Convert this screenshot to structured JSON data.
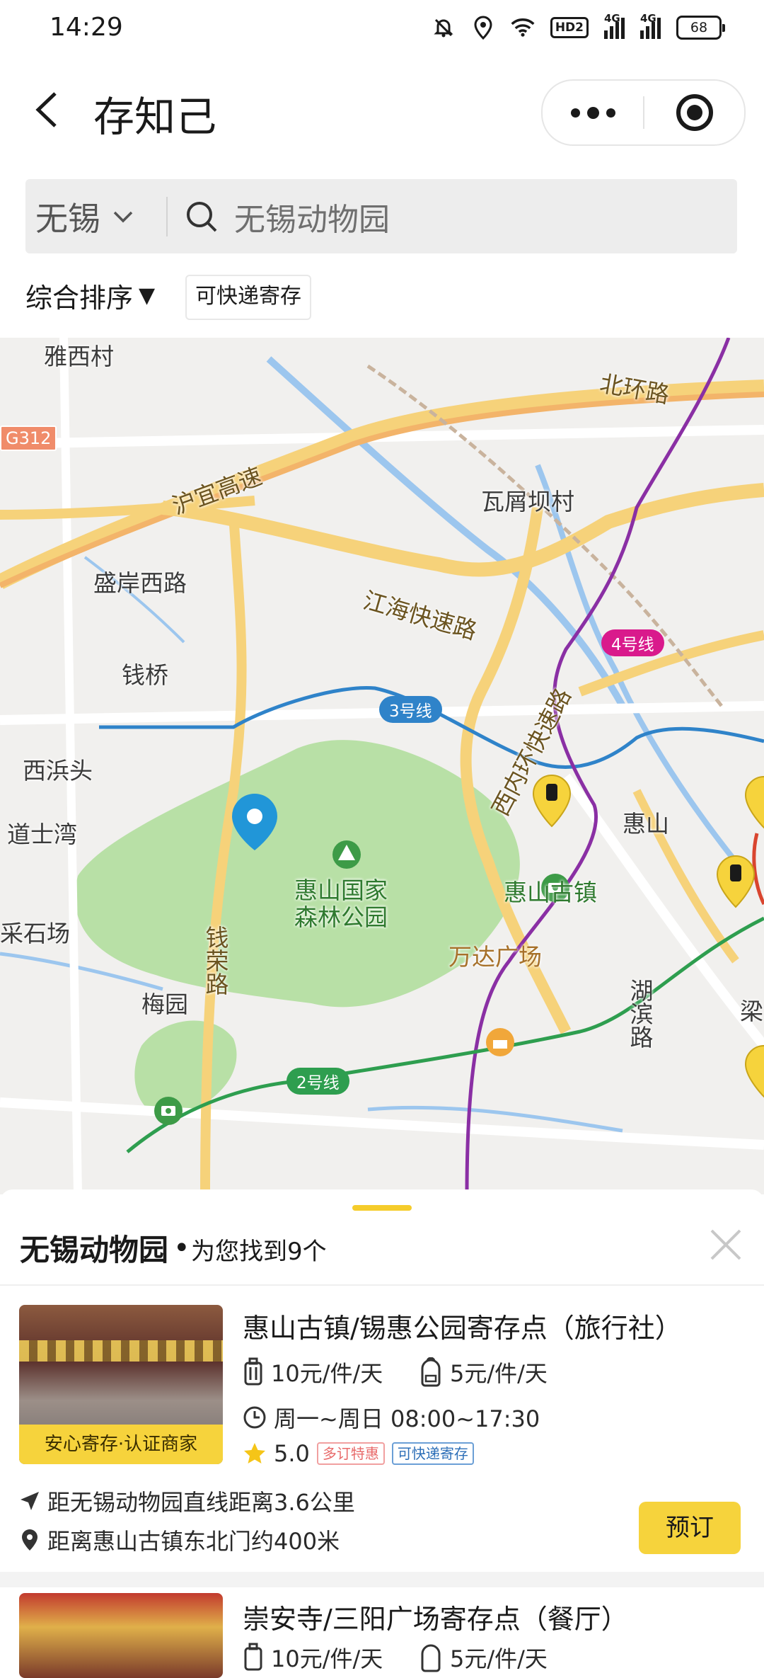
{
  "status_bar": {
    "time": "14:29",
    "hd_label": "HD2",
    "net1": "4G",
    "net2": "4G",
    "battery": "68"
  },
  "nav": {
    "title": "存知己"
  },
  "search": {
    "city": "无锡",
    "query": "无锡动物园"
  },
  "filters": {
    "sort_label": "综合排序",
    "sort_arrow": "▼",
    "express_label": "可快递寄存"
  },
  "map": {
    "places": {
      "yaxicun": "雅西村",
      "g312": "G312",
      "huyi": "沪宜高速",
      "beihuan": "北环路",
      "wapei": "瓦屑坝村",
      "shengan": "盛岸西路",
      "jianghai": "江海快速路",
      "qianqiao": "钱桥",
      "xibintou": "西浜头",
      "daoshiwan": "道士湾",
      "huishan_forest": "惠山国家\n森林公园",
      "huishan_town": "惠山古镇",
      "huishan": "惠山",
      "xihuan": "西内环快速路",
      "caishichang": "采石场",
      "qianrong": "钱荣路",
      "wanda": "万达广场",
      "meiyuan": "梅园",
      "hubin": "湖滨路",
      "liang": "梁"
    },
    "lines": {
      "line2": "2号线",
      "line3": "3号线",
      "line4": "4号线"
    },
    "colors": {
      "line2": "#2e9e4f",
      "line3": "#2f83c9",
      "line4": "#d91a8c",
      "line1": "#8a2fa4",
      "pin": "#2196d8"
    }
  },
  "sheet": {
    "title": "无锡动物园",
    "dot": "•",
    "count": "为您找到9个"
  },
  "cards": [
    {
      "badge": "安心寄存·认证商家",
      "name": "惠山古镇/锡惠公园寄存点（旅行社）",
      "price_luggage": "10元/件/天",
      "price_bag": "5元/件/天",
      "hours": "周一~周日 08:00~17:30",
      "rating": "5.0",
      "tags": [
        "多订特惠",
        "可快递寄存"
      ],
      "dist_straight": "距无锡动物园直线距离3.6公里",
      "dist_landmark": "距离惠山古镇东北门约400米",
      "book_label": "预订"
    },
    {
      "name": "崇安寺/三阳广场寄存点（餐厅）",
      "price_luggage": "10元/件/天",
      "price_bag": "5元/件/天"
    }
  ]
}
